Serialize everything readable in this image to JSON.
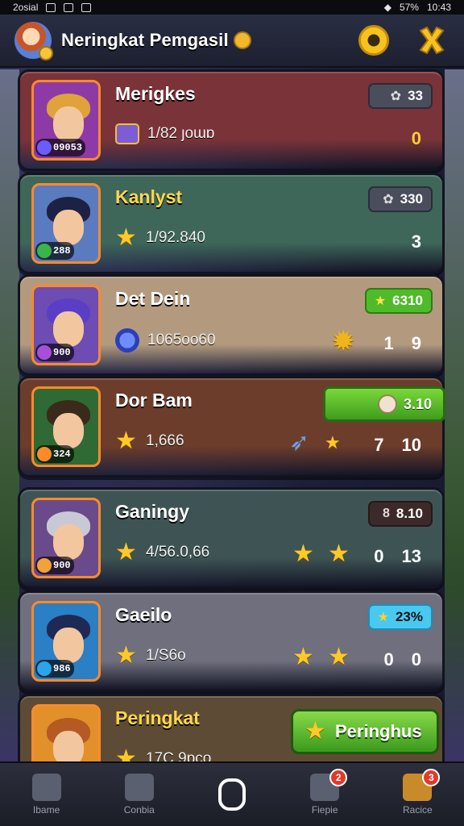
{
  "status_bar": {
    "left_text": "2osial",
    "battery": "57%",
    "time": "10:43"
  },
  "header": {
    "title": "Neringkat Pemgasil",
    "refresh_icon": "refresh-icon",
    "close_icon": "close-x-icon"
  },
  "players": [
    {
      "name": "Merigkes",
      "badge": "09053",
      "sub_icon": "ticket-icon",
      "sub_value": "1/82 ȷoɯɒ",
      "score": "33",
      "score_icon": "gear-icon",
      "right_values": [
        "0"
      ],
      "bg": "#7a3338",
      "frame": "#ff8a2a",
      "hair": "#e0a23a",
      "portrait_bg": "#8d3aa7",
      "gem": "#6a5cff"
    },
    {
      "name": "Kanlyst",
      "badge": "288",
      "sub_icon": "star-icon",
      "sub_value": "1/92.840",
      "score": "330",
      "score_icon": "gear-icon",
      "right_values": [
        "3"
      ],
      "bg": "#3e6659",
      "frame": "#ff8a2a",
      "hair": "#1d2244",
      "portrait_bg": "#5a7bc0",
      "gem": "#39b54a"
    },
    {
      "name": "Det Dein",
      "badge": "900",
      "sub_icon": "blue-coin-icon",
      "sub_value": "1065oo60",
      "score": "6310",
      "score_icon": "star-icon",
      "right_values": [
        "1",
        "9"
      ],
      "bg": "#b39a7e",
      "frame": "#ff8a2a",
      "hair": "#5a3fc6",
      "portrait_bg": "#6d4cb3",
      "gem": "#a74fd8"
    },
    {
      "name": "Dor Bam",
      "badge": "324",
      "sub_icon": "star-icon",
      "sub_value": "1,666",
      "score": "3.10",
      "score_icon": "ball-icon",
      "right_values": [
        "7",
        "10"
      ],
      "bg": "#6c3d2b",
      "frame": "#ff8a2a",
      "hair": "#3a2a1a",
      "portrait_bg": "#2f6a34",
      "gem": "#ff8a2a"
    },
    {
      "name": "Ganingy",
      "badge": "900",
      "sub_icon": "star-icon",
      "sub_value": "4/56.0,66",
      "score": "8.10",
      "score_icon": "8",
      "right_values": [
        "0",
        "13"
      ],
      "bg": "#3e5454",
      "frame": "#ff8a2a",
      "hair": "#c9c9d6",
      "portrait_bg": "#6a4a8a",
      "gem": "#f2a23a"
    },
    {
      "name": "Gaeilo",
      "badge": "986",
      "sub_icon": "star-icon",
      "sub_value": "1/S6o",
      "score": "23%",
      "score_icon": "star-icon",
      "right_values": [
        "0",
        "0"
      ],
      "bg": "#6f6f7d",
      "frame": "#ff8a2a",
      "hair": "#1e2a55",
      "portrait_bg": "#2b7fc4",
      "gem": "#2aa5e8"
    },
    {
      "name": "Peringkat",
      "sub_icon": "star-icon",
      "sub_value": "17C 9ɒco",
      "button_label": "Peringhus",
      "bg": "#5d4b35",
      "frame": "#ff8a2a",
      "hair": "#b45a22",
      "portrait_bg": "#e2902a",
      "gem": "#ffd02a"
    }
  ],
  "bottom_nav": [
    {
      "label": "Ibame",
      "icon": "home-icon",
      "badge": ""
    },
    {
      "label": "Conbia",
      "icon": "chat-icon",
      "badge": ""
    },
    {
      "label": "",
      "icon": "center-button-icon",
      "badge": ""
    },
    {
      "label": "Fiepie",
      "icon": "people-icon",
      "badge": "2"
    },
    {
      "label": "Racice",
      "icon": "shop-icon",
      "badge": "3"
    }
  ]
}
